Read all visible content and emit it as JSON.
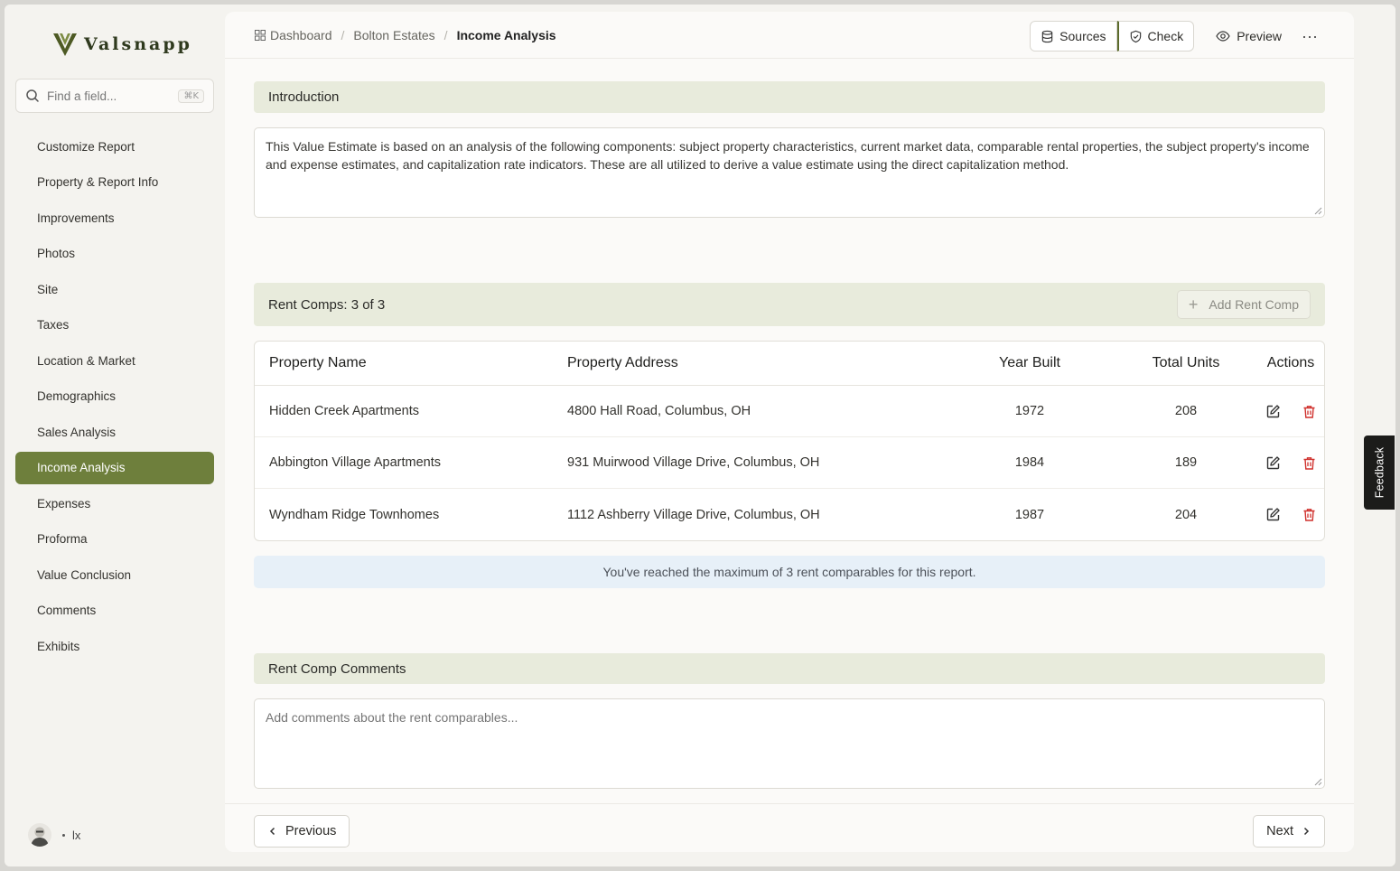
{
  "app": {
    "logo_text": "Valsnapp"
  },
  "search": {
    "placeholder": "Find a field...",
    "shortcut": "⌘K"
  },
  "sidebar": {
    "items": [
      {
        "label": "Customize Report",
        "active": false
      },
      {
        "label": "Property & Report Info",
        "active": false
      },
      {
        "label": "Improvements",
        "active": false
      },
      {
        "label": "Photos",
        "active": false
      },
      {
        "label": "Site",
        "active": false
      },
      {
        "label": "Taxes",
        "active": false
      },
      {
        "label": "Location & Market",
        "active": false
      },
      {
        "label": "Demographics",
        "active": false
      },
      {
        "label": "Sales Analysis",
        "active": false
      },
      {
        "label": "Income Analysis",
        "active": true
      },
      {
        "label": "Expenses",
        "active": false
      },
      {
        "label": "Proforma",
        "active": false
      },
      {
        "label": "Value Conclusion",
        "active": false
      },
      {
        "label": "Comments",
        "active": false
      },
      {
        "label": "Exhibits",
        "active": false
      }
    ]
  },
  "user": {
    "name": "lx"
  },
  "breadcrumb": {
    "home": "Dashboard",
    "project": "Bolton Estates",
    "current": "Income Analysis"
  },
  "toolbar": {
    "sources": "Sources",
    "check": "Check",
    "preview": "Preview",
    "more": "···"
  },
  "intro": {
    "title": "Introduction",
    "text": "This Value Estimate is based on an analysis of the following components: subject property characteristics, current market data, comparable rental properties, the subject property's income and expense estimates, and capitalization rate indicators. These are all utilized to derive a value estimate using the direct capitalization method."
  },
  "rent_comps": {
    "title": "Rent Comps: 3 of 3",
    "add_label": "Add Rent Comp",
    "columns": [
      "Property Name",
      "Property Address",
      "Year Built",
      "Total Units",
      "Actions"
    ],
    "rows": [
      {
        "name": "Hidden Creek Apartments",
        "address": "4800 Hall Road, Columbus, OH",
        "year": "1972",
        "units": "208"
      },
      {
        "name": "Abbington Village Apartments",
        "address": "931 Muirwood Village Drive, Columbus, OH",
        "year": "1984",
        "units": "189"
      },
      {
        "name": "Wyndham Ridge Townhomes",
        "address": "1112 Ashberry Village Drive, Columbus, OH",
        "year": "1987",
        "units": "204"
      }
    ],
    "notice": "You've reached the maximum of 3 rent comparables for this report."
  },
  "comments": {
    "title": "Rent Comp Comments",
    "placeholder": "Add comments about the rent comparables..."
  },
  "footer": {
    "previous": "Previous",
    "next": "Next"
  },
  "feedback": {
    "label": "Feedback"
  },
  "colors": {
    "accent": "#6e7f3c",
    "section_bg": "#e8ebdc",
    "delete": "#d0312d",
    "notice_bg": "#e7f0f8"
  }
}
